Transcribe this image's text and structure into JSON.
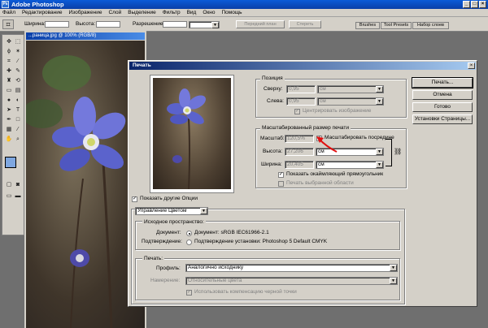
{
  "app": {
    "title": "Adobe Photoshop",
    "title_minimize": "_",
    "title_maximize": "□",
    "title_close": "×"
  },
  "menu": [
    "Файл",
    "Редактирование",
    "Изображение",
    "Слой",
    "Выделение",
    "Фильтр",
    "Вид",
    "Окно",
    "Помощь"
  ],
  "options_bar": {
    "width_label": "Ширина:",
    "height_label": "Высота:",
    "resolution_label": "Разрешение:",
    "front_image_button": "Передний план",
    "clear_button": "Стереть"
  },
  "palette_tabs": [
    "Brushes",
    "Tool Presets",
    "Набор слоев"
  ],
  "document": {
    "title": "...раница.jpg @ 100% (RGB/8)"
  },
  "dialog": {
    "title": "Печать",
    "close": "×",
    "buttons": {
      "print": "Печать...",
      "cancel": "Отмена",
      "done": "Готово",
      "page_setup": "Установки Страницы..."
    },
    "position": {
      "legend": "Позиция",
      "top_label": "Сверху:",
      "top_value": "0,95",
      "top_unit": "см",
      "left_label": "Слева:",
      "left_value": "0,95",
      "left_unit": "см",
      "center_label": "Центрировать изображение"
    },
    "scaled": {
      "legend": "Масштабированный размер печати",
      "scale_label": "Масштаб:",
      "scale_value": "120,5%",
      "scale_to_media": "Масштабировать посредине",
      "height_label": "Высота:",
      "height_value": "27,206",
      "height_unit": "см",
      "width_label": "Ширина:",
      "width_value": "20,405",
      "width_unit": "см",
      "show_bbox": "Показать окаймляющий прямоугольник",
      "print_selected": "Печать выбранной области"
    },
    "show_more": "Показать другие Опции",
    "color_mgmt_select": "Управление Цветом",
    "source": {
      "legend": "Исходное пространство:",
      "doc_label": "Документ:",
      "doc_option": "Документ:  sRGB IEC61966-2.1",
      "proof_label": "Подтверждение:",
      "proof_option": "Подтверждение установки: Photoshop 5 Default CMYK"
    },
    "print_space": {
      "legend": "Печать:",
      "profile_label": "Профиль:",
      "profile_value": "Аналогично исходнику",
      "intent_label": "Намерение:",
      "intent_value": "Относительные цвета",
      "bpc_label": "Использовать компенсацию черной точки"
    }
  },
  "colors": {
    "accent": "#0a246a",
    "face": "#d4d0c8",
    "petal": "#6e74d8",
    "arrow": "#e01010"
  }
}
